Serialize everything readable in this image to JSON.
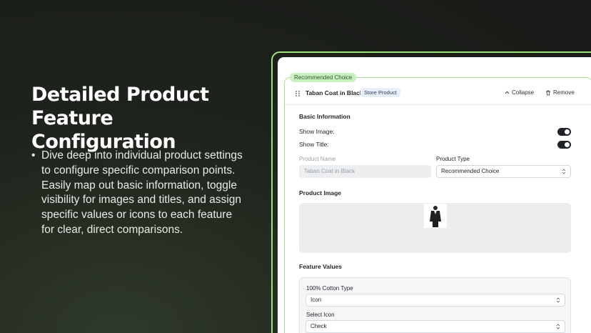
{
  "hero": {
    "title": "Detailed Product Feature Configuration",
    "bullets": [
      "Dive deep into individual product settings to configure specific comparison points. Easily map out basic information, toggle visibility for images and titles, and assign specific values or icons to each feature for clear, direct comparisons."
    ]
  },
  "colors": {
    "accent": "#9be07a",
    "background": "#1e231c"
  },
  "card": {
    "tag": "Recommended Choice",
    "header": {
      "title": "Taban Coat in Black",
      "badge": "Store Product",
      "collapse_label": "Collapse",
      "remove_label": "Remove",
      "icons": {
        "drag": "drag-handle-icon",
        "collapse": "chevron-up-icon",
        "remove": "trash-icon"
      }
    },
    "basic_info": {
      "title": "Basic Information",
      "show_image_label": "Show Image:",
      "show_image": true,
      "show_title_label": "Show Title:",
      "show_title": true,
      "product_name_label": "Product Name",
      "product_name_value": "Taban Coat in Black",
      "product_type_label": "Product Type",
      "product_type_value": "Recommended Choice"
    },
    "product_image": {
      "title": "Product Image"
    },
    "feature_values": {
      "title": "Feature Values",
      "feature_label": "100% Cotton Type",
      "feature_value": "Icon",
      "select_icon_label": "Select Icon",
      "select_icon_value": "Check"
    }
  }
}
